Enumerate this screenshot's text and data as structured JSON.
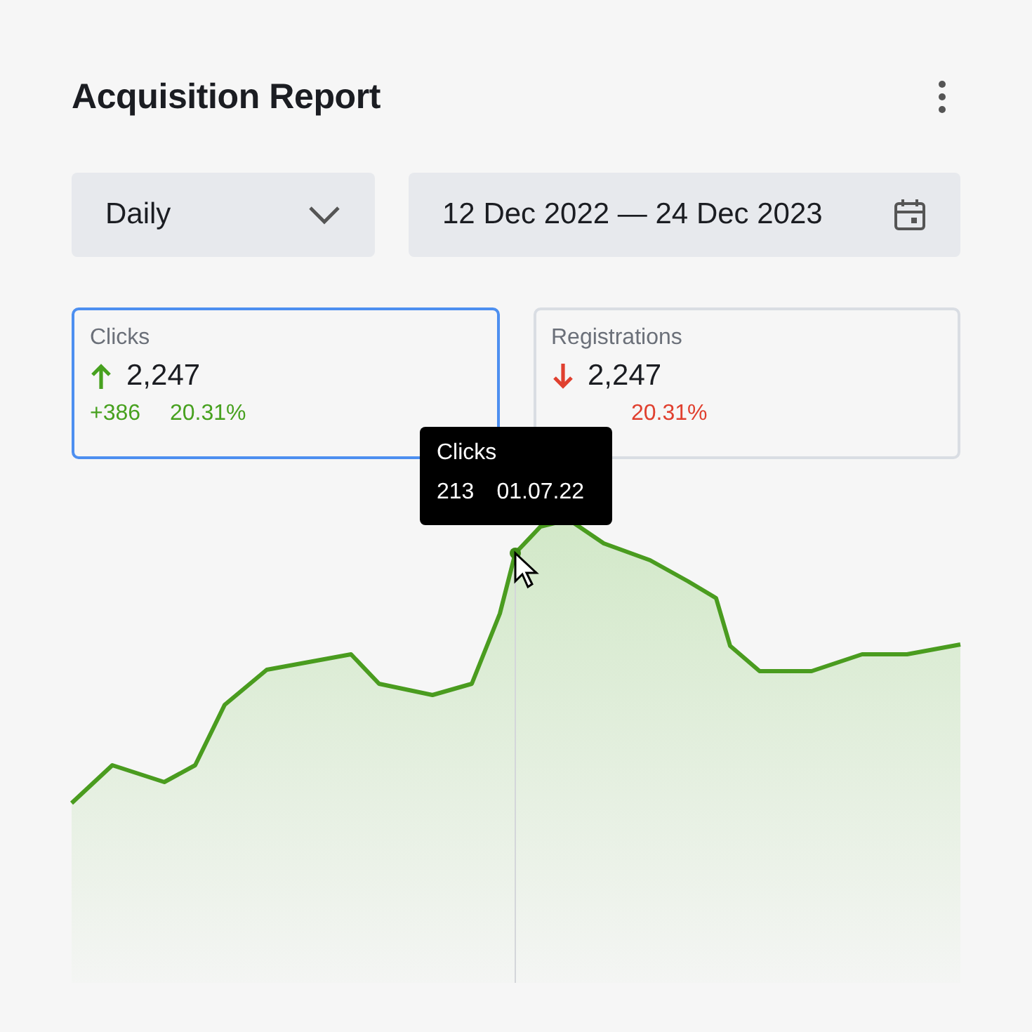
{
  "title": "Acquisition Report",
  "period": {
    "value": "Daily"
  },
  "date_range": {
    "value": "12 Dec 2022 — 24 Dec 2023"
  },
  "metrics": [
    {
      "label": "Clicks",
      "selected": true,
      "rising": true,
      "value": "2,247",
      "change": "+386",
      "percent": "20.31%"
    },
    {
      "label": "Registrations",
      "selected": false,
      "rising": false,
      "value": "2,247",
      "percent": "20.31%"
    }
  ],
  "tooltip": {
    "series": "Clicks",
    "value": "213",
    "date": "01.07.22"
  }
}
